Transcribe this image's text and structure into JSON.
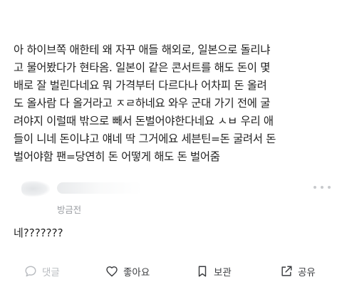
{
  "post": {
    "lines": [
      "아 하이브쪽 애한테 왜 자꾸 애들 해외로, 일본으로 돌리냐",
      "고 물어봤다가 현타옴. 일본이 같은 콘서트를 해도 돈이 몇",
      "배로 잘 벌린다네요 뭐 가격부터 다르다나 어차피 돈 올려",
      "도 올사람 다 올거라고 ㅈㄹ하네요 와우 군대 가기 전에 굴",
      "려야지 이럴때 밖으로 빼서 돈벌어야한다네요 ㅅㅂ 우리 애",
      "들이 니네 돈이냐고 얘네 딱 그거에요 세븐틴=돈 굴려서 돈",
      "벌어야함 팬=당연히 돈 어떻게 해도 돈 벌어줌"
    ]
  },
  "reply": {
    "time": "방금전",
    "text": "네???????"
  },
  "actions": {
    "comment": {
      "label": "댓글",
      "icon": "comment-icon"
    },
    "like": {
      "label": "좋아요",
      "icon": "heart-icon"
    },
    "save": {
      "label": "보관",
      "icon": "bookmark-icon"
    },
    "share": {
      "label": "공유",
      "icon": "share-icon"
    }
  },
  "colors": {
    "text": "#1f1f1f",
    "muted": "#9a9da2",
    "action": "#3b3d40",
    "disabled": "#b9bcc0"
  }
}
